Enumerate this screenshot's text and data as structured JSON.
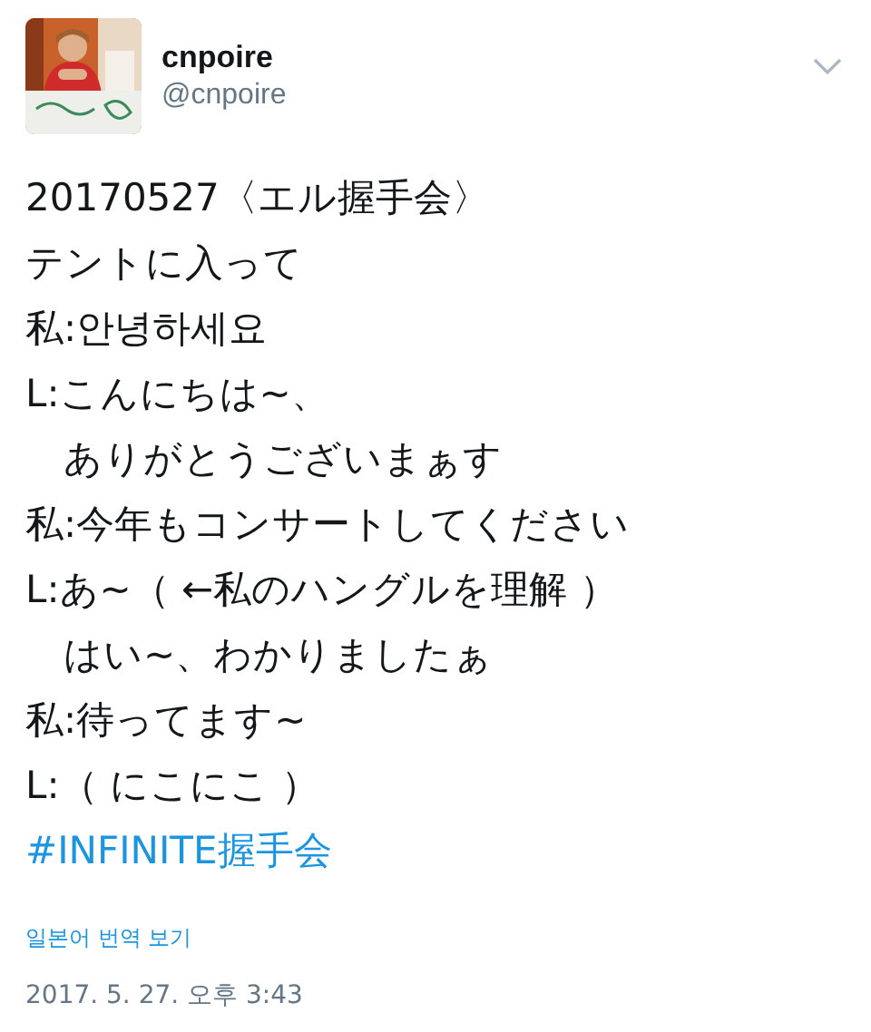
{
  "user": {
    "name": "cnpoire",
    "handle": "@cnpoire"
  },
  "tweet": {
    "lines": [
      "20170527〈エル握手会〉",
      "テントに入って",
      "私:안녕하세요",
      "L:こんにちは~、",
      "　ありがとうございまぁす",
      "私:今年もコンサートしてください",
      "L:あ~（ ←私のハングルを理解 ）",
      "　はい~、わかりましたぁ",
      "私:待ってます~",
      "L:（ にこにこ ）"
    ],
    "hashtag": "#INFINITE握手会",
    "translate_link": "일본어 번역 보기",
    "timestamp": "2017. 5. 27. 오후 3:43"
  }
}
